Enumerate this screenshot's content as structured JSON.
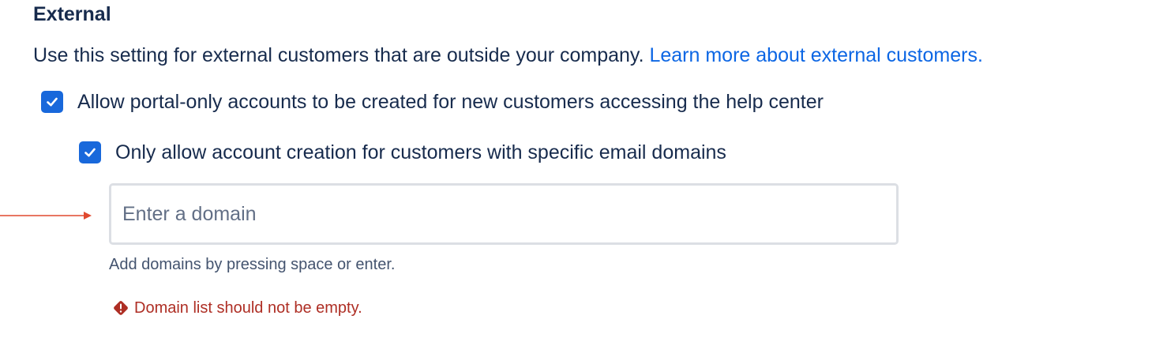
{
  "section": {
    "title": "External",
    "description": "Use this setting for external customers that are outside your company. ",
    "learn_more_link": "Learn more about external customers."
  },
  "options": [
    {
      "label": "Allow portal-only accounts to be created for new customers accessing the help center",
      "checked": true
    },
    {
      "label": "Only allow account creation for customers with specific email domains",
      "checked": true
    }
  ],
  "domain_input": {
    "value": "",
    "placeholder": "Enter a domain",
    "helper_text": "Add domains by pressing space or enter.",
    "error_text": "Domain list should not be empty."
  },
  "colors": {
    "checkbox": "#1868db",
    "link": "#0c66e4",
    "error": "#ae2e24",
    "annotation_arrow": "#e0492f"
  }
}
